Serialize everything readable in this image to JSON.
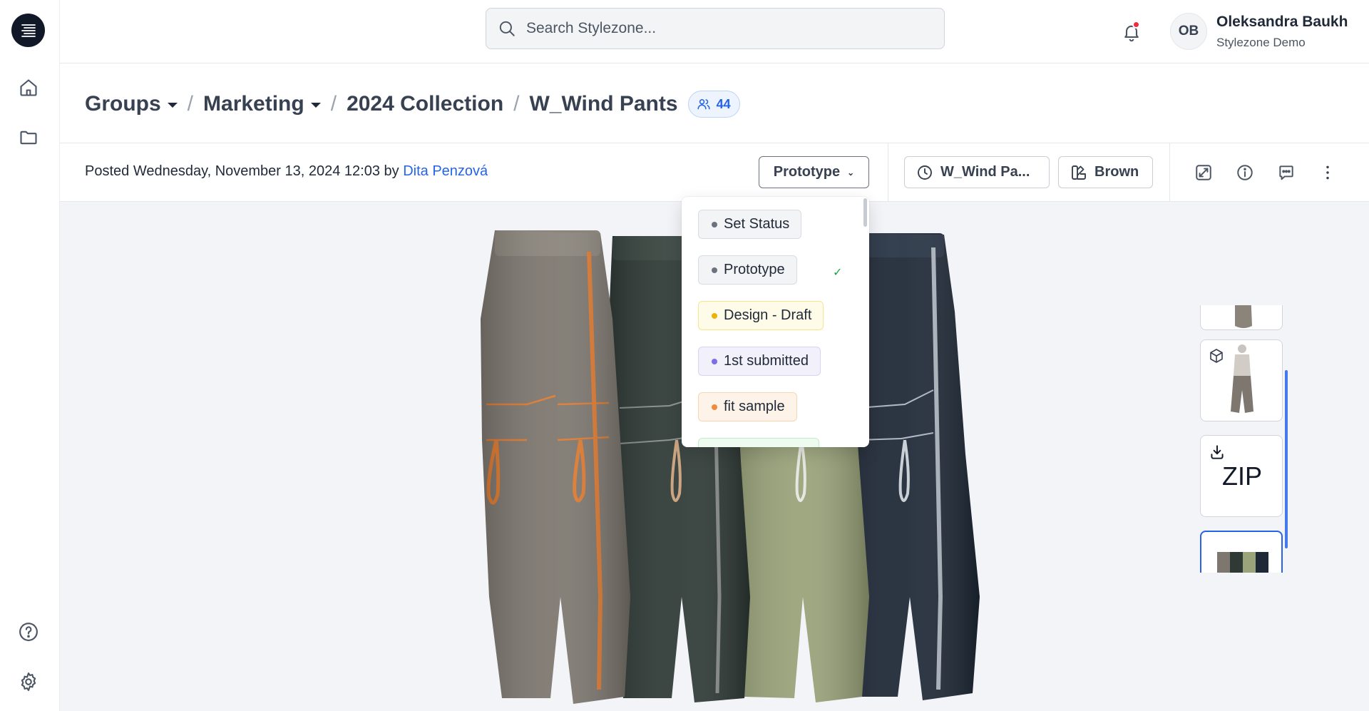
{
  "search": {
    "placeholder": "Search Stylezone..."
  },
  "user": {
    "initials": "OB",
    "name": "Oleksandra Baukh",
    "org": "Stylezone Demo"
  },
  "breadcrumb": {
    "items": [
      {
        "label": "Groups",
        "dropdown": true
      },
      {
        "label": "Marketing",
        "dropdown": true
      },
      {
        "label": "2024 Collection",
        "dropdown": false
      },
      {
        "label": "W_Wind Pants",
        "dropdown": false
      }
    ],
    "separator": "/",
    "member_count": "44"
  },
  "post": {
    "prefix": "Posted Wednesday, November 13, 2024 12:03 by",
    "author": "Dita Penzová"
  },
  "toolbar": {
    "status_label": "Prototype",
    "version_label": "W_Wind Pa...",
    "colorway_label": "Brown",
    "icons": [
      "expand-icon",
      "info-icon",
      "comment-icon",
      "more-vertical-icon"
    ]
  },
  "status_menu": {
    "options": [
      {
        "label": "Set Status",
        "color": "#6b7280",
        "bg": "#f3f4f6",
        "border": "#d8dce2",
        "selected": false
      },
      {
        "label": "Prototype",
        "color": "#6b7280",
        "bg": "#f3f4f6",
        "border": "#d8dce2",
        "selected": true
      },
      {
        "label": "Design - Draft",
        "color": "#eab308",
        "bg": "#fefbe8",
        "border": "#f7e58d",
        "selected": false
      },
      {
        "label": "1st submitted",
        "color": "#7c6ee6",
        "bg": "#f1f0fb",
        "border": "#d7d3f4",
        "selected": false
      },
      {
        "label": "fit sample",
        "color": "#f08a3c",
        "bg": "#fef3e8",
        "border": "#f9d5ae",
        "selected": false
      },
      {
        "label": "",
        "color": "#22c55e",
        "bg": "#eefbf1",
        "border": "#bfecc9",
        "selected": false
      }
    ]
  },
  "thumbnails": {
    "items": [
      {
        "kind": "image-partial",
        "icon": ""
      },
      {
        "kind": "avatar-3d",
        "icon": "cube-icon"
      },
      {
        "kind": "zip",
        "icon": "download-icon",
        "label": "ZIP"
      },
      {
        "kind": "image-selected",
        "icon": ""
      }
    ]
  },
  "colors": {
    "accent": "#2563eb",
    "notification": "#ef2b3c",
    "pant_colors": [
      "#7d776f",
      "#2f3a36",
      "#9aa37a",
      "#1e2836"
    ],
    "trim_colors": [
      "#e07a2f",
      "#8a8f8c",
      "#b7bdc5",
      "#aeb7c1"
    ]
  }
}
